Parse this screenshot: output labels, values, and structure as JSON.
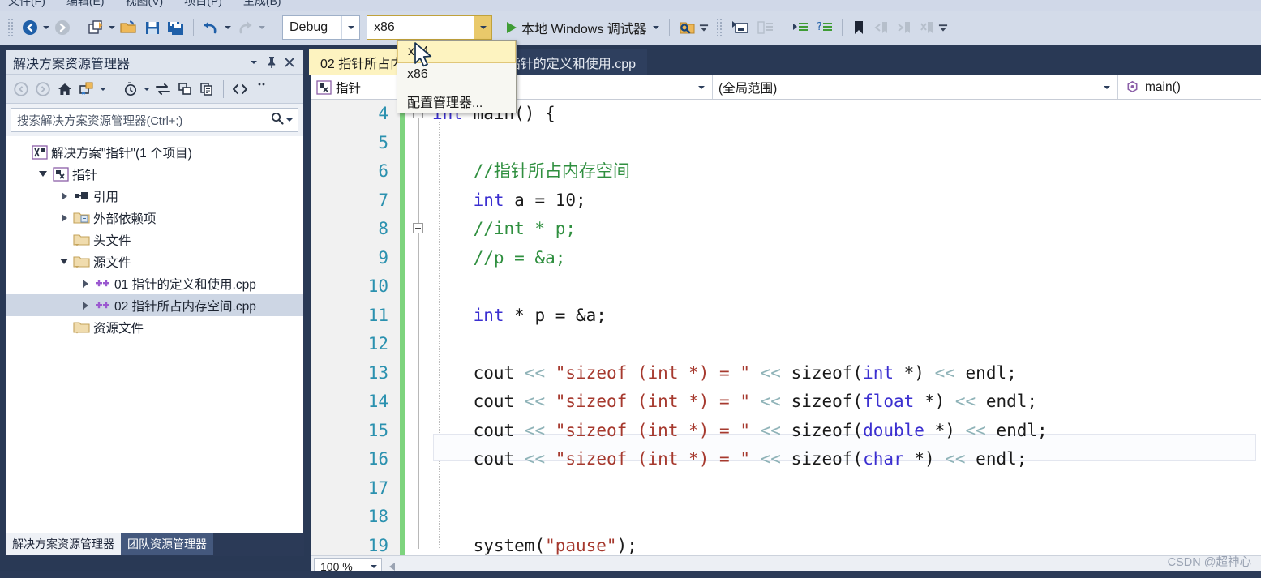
{
  "menu": {
    "items": [
      "文件(F)",
      "编辑(E)",
      "视图(V)",
      "项目(P)",
      "生成(B)"
    ]
  },
  "toolbar": {
    "nav_back_icon": "navigate-back-icon",
    "nav_forward_icon": "navigate-forward-icon",
    "new_project_icon": "new-project-icon",
    "open_file_icon": "open-file-icon",
    "save_icon": "save-icon",
    "save_all_icon": "save-all-icon",
    "undo_icon": "undo-icon",
    "redo_icon": "redo-icon",
    "configuration": "Debug",
    "platform": "x86",
    "run_label": "本地 Windows 调试器",
    "find_icon": "find-in-files-icon",
    "window_icon": "window-icon",
    "compare_icon": "compare-icon",
    "indent_icon": "increase-indent-icon",
    "comment_icon": "comment-icon",
    "bookmark_icon": "bookmark-icon",
    "prev_bookmark_icon": "previous-bookmark-icon",
    "next_bookmark_icon": "next-bookmark-icon",
    "clear_bookmark_icon": "clear-bookmarks-icon",
    "overflow_icon": "toolbar-overflow-icon"
  },
  "platform_dropdown": {
    "open": true,
    "options": [
      "x64",
      "x86",
      "配置管理器..."
    ],
    "highlighted": "x64"
  },
  "solution_explorer": {
    "title": "解决方案资源管理器",
    "title_buttons": {
      "dropdown_icon": "chevron-down-icon",
      "pin_icon": "pin-icon",
      "close_icon": "close-icon"
    },
    "toolbar_icons": [
      "back-icon",
      "forward-icon",
      "home-icon",
      "sync-with-active-document-icon",
      "pending-changes-filter-icon",
      "refresh-icon",
      "collapse-all-icon",
      "properties-icon",
      "show-all-files-icon",
      "overflow-icon"
    ],
    "search_placeholder": "搜索解决方案资源管理器(Ctrl+;)",
    "search_icon": "search-icon",
    "tree": [
      {
        "label": "解决方案\"指针\"(1 个项目)",
        "icon": "solution-icon",
        "indent": 0,
        "expander": "none",
        "selected": false
      },
      {
        "label": "指针",
        "icon": "cpp-project-icon",
        "indent": 1,
        "expander": "down",
        "selected": false
      },
      {
        "label": "引用",
        "icon": "references-icon",
        "indent": 2,
        "expander": "right",
        "selected": false
      },
      {
        "label": "外部依赖项",
        "icon": "external-deps-folder-icon",
        "indent": 2,
        "expander": "right",
        "selected": false
      },
      {
        "label": "头文件",
        "icon": "filter-folder-icon",
        "indent": 2,
        "expander": "none",
        "selected": false
      },
      {
        "label": "源文件",
        "icon": "filter-folder-icon",
        "indent": 2,
        "expander": "down",
        "selected": false
      },
      {
        "label": "01 指针的定义和使用.cpp",
        "icon": "cpp-file-icon",
        "indent": 3,
        "expander": "right",
        "selected": false
      },
      {
        "label": "02 指针所占内存空间.cpp",
        "icon": "cpp-file-icon",
        "indent": 3,
        "expander": "right",
        "selected": true
      },
      {
        "label": "资源文件",
        "icon": "filter-folder-icon",
        "indent": 2,
        "expander": "none",
        "selected": false
      }
    ],
    "bottom_tabs": [
      {
        "label": "解决方案资源管理器",
        "active": true
      },
      {
        "label": "团队资源管理器",
        "active": false
      }
    ]
  },
  "editor": {
    "tabs": [
      {
        "label": "02 指针所占内存空间.cpp",
        "active": true
      },
      {
        "label": "01 指针的定义和使用.cpp",
        "active": false
      }
    ],
    "navbar": {
      "project": "指针",
      "project_icon": "cpp-project-icon",
      "scope": "(全局范围)",
      "member": "main()",
      "member_icon": "method-icon",
      "dropdown_icon": "chevron-down-icon"
    },
    "zoom_level": "100 %",
    "lines": [
      {
        "n": "4",
        "tokens": [
          {
            "t": "int",
            "c": "kw"
          },
          {
            "t": " main() {",
            "c": "pl"
          }
        ]
      },
      {
        "n": "5",
        "tokens": []
      },
      {
        "n": "6",
        "tokens": [
          {
            "t": "    //指针所占内存空间",
            "c": "cm"
          }
        ]
      },
      {
        "n": "7",
        "tokens": [
          {
            "t": "    ",
            "c": "pl"
          },
          {
            "t": "int",
            "c": "kw"
          },
          {
            "t": " a = 10;",
            "c": "pl"
          }
        ]
      },
      {
        "n": "8",
        "tokens": [
          {
            "t": "    //int * p;",
            "c": "cm"
          }
        ]
      },
      {
        "n": "9",
        "tokens": [
          {
            "t": "    //p = &a;",
            "c": "cm"
          }
        ]
      },
      {
        "n": "10",
        "tokens": []
      },
      {
        "n": "11",
        "tokens": [
          {
            "t": "    ",
            "c": "pl"
          },
          {
            "t": "int",
            "c": "kw"
          },
          {
            "t": " * p = &a;",
            "c": "pl"
          }
        ]
      },
      {
        "n": "12",
        "tokens": []
      },
      {
        "n": "13",
        "tokens": [
          {
            "t": "    cout ",
            "c": "pl"
          },
          {
            "t": "<<",
            "c": "op"
          },
          {
            "t": " ",
            "c": "pl"
          },
          {
            "t": "\"sizeof (int *) = \"",
            "c": "str"
          },
          {
            "t": " ",
            "c": "pl"
          },
          {
            "t": "<<",
            "c": "op"
          },
          {
            "t": " sizeof(",
            "c": "pl"
          },
          {
            "t": "int",
            "c": "kw"
          },
          {
            "t": " *) ",
            "c": "pl"
          },
          {
            "t": "<<",
            "c": "op"
          },
          {
            "t": " endl;",
            "c": "pl"
          }
        ]
      },
      {
        "n": "14",
        "tokens": [
          {
            "t": "    cout ",
            "c": "pl"
          },
          {
            "t": "<<",
            "c": "op"
          },
          {
            "t": " ",
            "c": "pl"
          },
          {
            "t": "\"sizeof (int *) = \"",
            "c": "str"
          },
          {
            "t": " ",
            "c": "pl"
          },
          {
            "t": "<<",
            "c": "op"
          },
          {
            "t": " sizeof(",
            "c": "pl"
          },
          {
            "t": "float",
            "c": "kw"
          },
          {
            "t": " *) ",
            "c": "pl"
          },
          {
            "t": "<<",
            "c": "op"
          },
          {
            "t": " endl;",
            "c": "pl"
          }
        ]
      },
      {
        "n": "15",
        "tokens": [
          {
            "t": "    cout ",
            "c": "pl"
          },
          {
            "t": "<<",
            "c": "op"
          },
          {
            "t": " ",
            "c": "pl"
          },
          {
            "t": "\"sizeof (int *) = \"",
            "c": "str"
          },
          {
            "t": " ",
            "c": "pl"
          },
          {
            "t": "<<",
            "c": "op"
          },
          {
            "t": " sizeof(",
            "c": "pl"
          },
          {
            "t": "double",
            "c": "kw"
          },
          {
            "t": " *) ",
            "c": "pl"
          },
          {
            "t": "<<",
            "c": "op"
          },
          {
            "t": " endl;",
            "c": "pl"
          }
        ]
      },
      {
        "n": "16",
        "tokens": [
          {
            "t": "    cout ",
            "c": "pl"
          },
          {
            "t": "<<",
            "c": "op"
          },
          {
            "t": " ",
            "c": "pl"
          },
          {
            "t": "\"sizeof (int *) = \"",
            "c": "str"
          },
          {
            "t": " ",
            "c": "pl"
          },
          {
            "t": "<<",
            "c": "op"
          },
          {
            "t": " sizeof(",
            "c": "pl"
          },
          {
            "t": "char",
            "c": "kw"
          },
          {
            "t": " *) ",
            "c": "pl"
          },
          {
            "t": "<<",
            "c": "op"
          },
          {
            "t": " endl;",
            "c": "pl"
          }
        ]
      },
      {
        "n": "17",
        "tokens": []
      },
      {
        "n": "18",
        "tokens": []
      },
      {
        "n": "19",
        "tokens": [
          {
            "t": "    system(",
            "c": "pl"
          },
          {
            "t": "\"pause\"",
            "c": "str"
          },
          {
            "t": ");",
            "c": "pl"
          }
        ]
      }
    ]
  },
  "watermark": "CSDN @超神心",
  "colors": {
    "chrome": "#293955",
    "toolbar": "#d3dbe9",
    "active_tab": "#fdf3c0",
    "change_bar": "#7ed47e",
    "keyword": "#3b2fd0",
    "comment": "#2f8f3f",
    "string": "#a6392e",
    "line_number": "#2b91af"
  }
}
